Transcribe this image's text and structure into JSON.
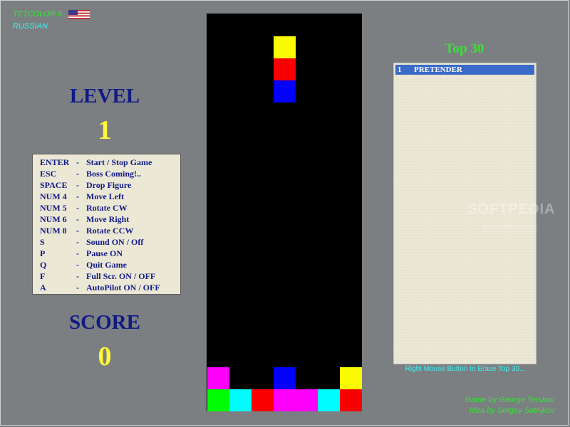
{
  "app": {
    "title": "TETCOLOR II",
    "language_link": "RUSSIAN",
    "flag_icon": "us-flag-icon"
  },
  "level": {
    "label": "LEVEL",
    "value": "1"
  },
  "score": {
    "label": "SCORE",
    "value": "0"
  },
  "controls": [
    {
      "key": "ENTER",
      "dash": "-",
      "action": "Start / Stop  Game"
    },
    {
      "key": "ESC",
      "dash": "-",
      "action": "Boss  Coming!.."
    },
    {
      "key": "SPACE",
      "dash": "-",
      "action": "Drop  Figure"
    },
    {
      "key": "NUM 4",
      "dash": "-",
      "action": "Move  Left"
    },
    {
      "key": "NUM 5",
      "dash": "-",
      "action": "Rotate  CW"
    },
    {
      "key": "NUM 6",
      "dash": "-",
      "action": "Move  Right"
    },
    {
      "key": "NUM 8",
      "dash": "-",
      "action": "Rotate  CCW"
    },
    {
      "key": "S",
      "dash": "-",
      "action": "Sound  ON / Off"
    },
    {
      "key": "P",
      "dash": "-",
      "action": "Pause  ON"
    },
    {
      "key": "Q",
      "dash": "-",
      "action": "Quit  Game"
    },
    {
      "key": "F",
      "dash": "-",
      "action": "Full  Scr.  ON / OFF"
    },
    {
      "key": "A",
      "dash": "-",
      "action": "AutoPilot  ON / OFF"
    }
  ],
  "board": {
    "columns": 7,
    "rows": 18,
    "falling_piece": [
      {
        "col": 3,
        "row": 1,
        "color": "yellow"
      },
      {
        "col": 3,
        "row": 2,
        "color": "red"
      },
      {
        "col": 3,
        "row": 3,
        "color": "blue"
      }
    ],
    "settled_blocks": [
      {
        "col": 0,
        "row": 16,
        "color": "magenta"
      },
      {
        "col": 3,
        "row": 16,
        "color": "blue"
      },
      {
        "col": 6,
        "row": 16,
        "color": "yellow"
      },
      {
        "col": 0,
        "row": 17,
        "color": "green"
      },
      {
        "col": 1,
        "row": 17,
        "color": "cyan"
      },
      {
        "col": 2,
        "row": 17,
        "color": "red"
      },
      {
        "col": 3,
        "row": 17,
        "color": "magenta"
      },
      {
        "col": 4,
        "row": 17,
        "color": "magenta"
      },
      {
        "col": 5,
        "row": 17,
        "color": "cyan"
      },
      {
        "col": 6,
        "row": 17,
        "color": "red"
      }
    ],
    "palette": {
      "yellow": "#fcfc00",
      "red": "#fc0000",
      "blue": "#0000fc",
      "magenta": "#fc00fc",
      "green": "#00fc00",
      "cyan": "#00fcfc"
    }
  },
  "top30": {
    "title": "Top 30",
    "entries": [
      {
        "rank": "1",
        "name": "PRETENDER"
      }
    ],
    "erase_note": "Right Mouse Button to Erase Top 30..."
  },
  "watermark": {
    "text": "SOFTPEDIA",
    "url": "www.softpedia.com"
  },
  "credits": {
    "game_by": "Game by George Terskov",
    "idea_by": "Idea by Sergey Sotnikov"
  }
}
